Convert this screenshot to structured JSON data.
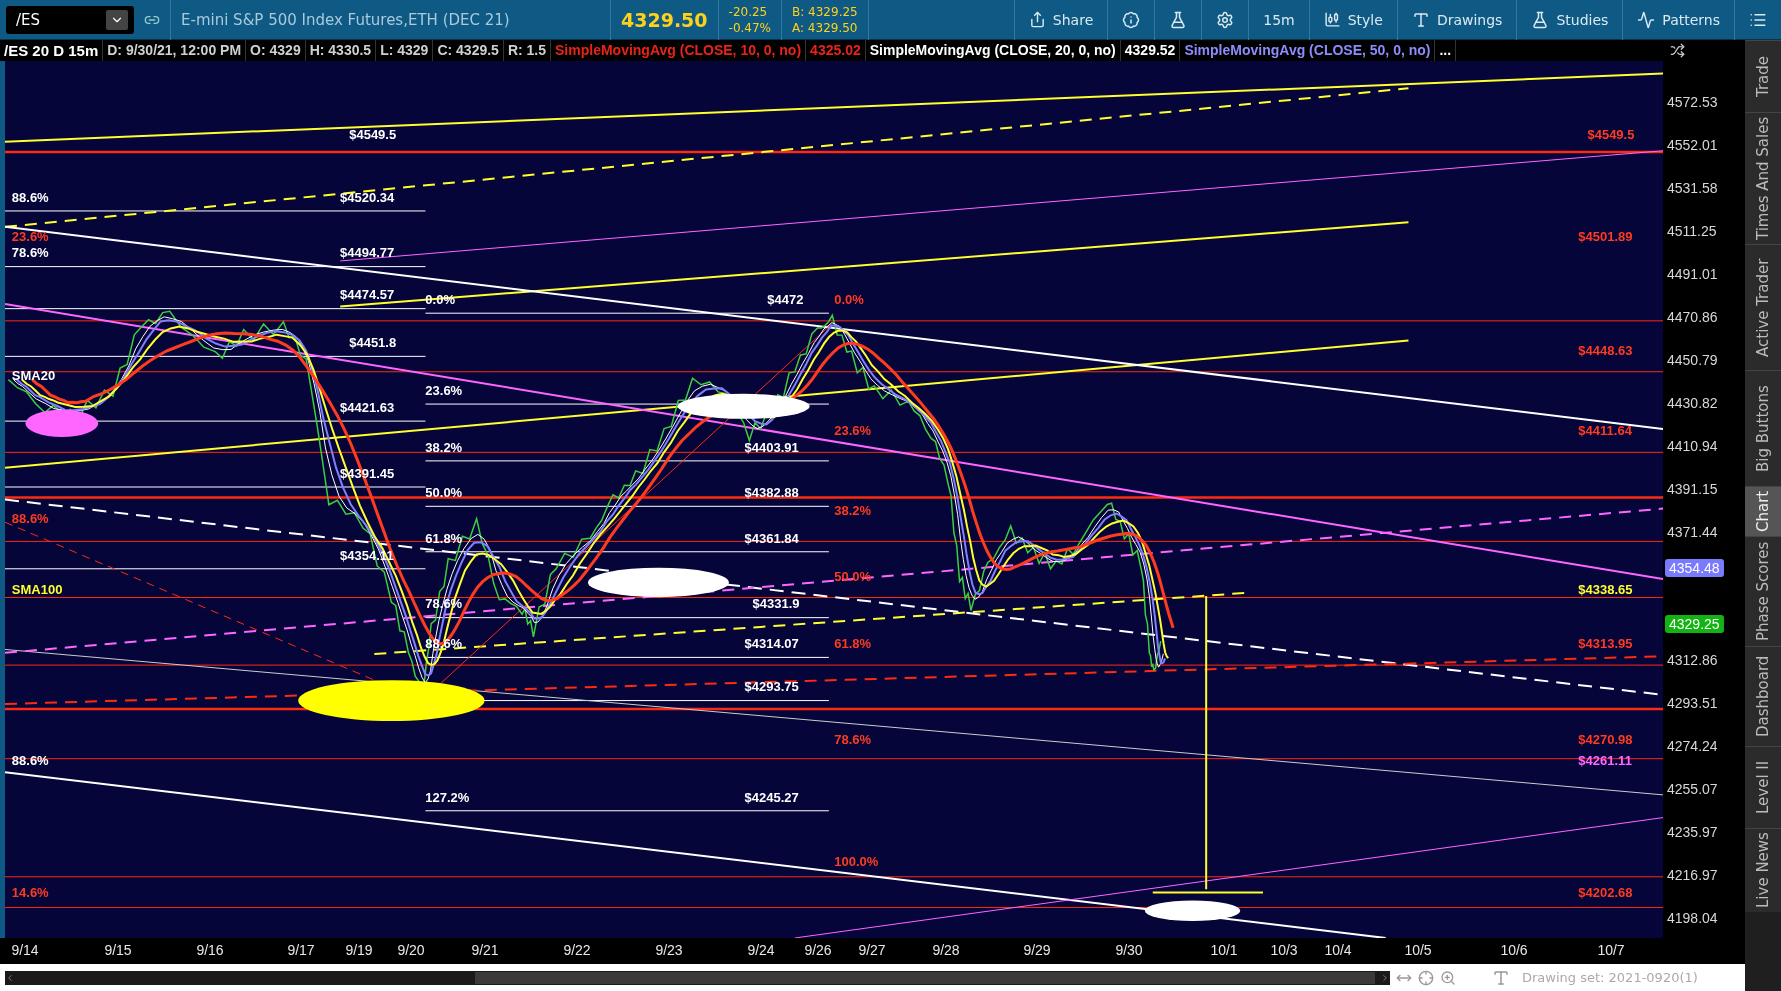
{
  "toolbar": {
    "symbol": "/ES",
    "description": "E-mini S&P 500 Index Futures,ETH (DEC 21)",
    "last_price": "4329.50",
    "change": "-20.25",
    "change_percent": "-0.47%",
    "bid": "B: 4329.25",
    "ask": "A: 4329.50",
    "buttons": [
      {
        "kind": "share",
        "label": "Share"
      },
      {
        "kind": "info"
      },
      {
        "kind": "flask"
      },
      {
        "kind": "gear"
      },
      {
        "kind": "plain",
        "label": "15m"
      },
      {
        "kind": "style",
        "label": "Style"
      },
      {
        "kind": "drawings",
        "label": "Drawings"
      },
      {
        "kind": "studies",
        "label": "Studies"
      },
      {
        "kind": "patterns",
        "label": "Patterns"
      },
      {
        "kind": "menu"
      }
    ]
  },
  "legend": [
    {
      "kind": "symbol",
      "text": "/ES 20 D 15m",
      "color": "#ffffff"
    },
    {
      "kind": "field",
      "text": "D: 9/30/21, 12:00 PM",
      "color": "#d0d0d0"
    },
    {
      "kind": "field",
      "text": "O: 4329",
      "color": "#d0d0d0"
    },
    {
      "kind": "field",
      "text": "H: 4330.5",
      "color": "#d0d0d0"
    },
    {
      "kind": "field",
      "text": "L: 4329",
      "color": "#d0d0d0"
    },
    {
      "kind": "field",
      "text": "C: 4329.5",
      "color": "#d0d0d0"
    },
    {
      "kind": "field",
      "text": "R: 1.5",
      "color": "#d0d0d0"
    },
    {
      "kind": "study",
      "text": "SimpleMovingAvg (CLOSE, 10, 0, no)",
      "color": "#e8241a"
    },
    {
      "kind": "study",
      "text": "4325.02",
      "color": "#e8241a"
    },
    {
      "kind": "study",
      "text": "SimpleMovingAvg (CLOSE, 20, 0, no)",
      "color": "#ffffff"
    },
    {
      "kind": "study",
      "text": "4329.52",
      "color": "#ffffff"
    },
    {
      "kind": "study",
      "text": "SimpleMovingAvg (CLOSE, 50, 0, no)",
      "color": "#8c8cff"
    },
    {
      "kind": "study",
      "text": "...",
      "color": "#ffffff"
    }
  ],
  "chart": {
    "annotations": [
      {
        "text": "88.6%",
        "color": "#ffffff"
      },
      {
        "text": "23.6%",
        "color": "#ff3b1f"
      },
      {
        "text": "78.6%",
        "color": "#ffffff"
      },
      {
        "text": "SMA20",
        "color": "#ffffff"
      },
      {
        "text": "88.6%",
        "color": "#ff3b1f"
      },
      {
        "text": "SMA100",
        "color": "#ffff2e"
      },
      {
        "text": "88.6%",
        "color": "#ffffff"
      },
      {
        "text": "14.6%",
        "color": "#ff3b1f"
      },
      {
        "text": "$4549.5",
        "color": "#ffffff"
      },
      {
        "text": "$4520.34",
        "color": "#ffffff"
      },
      {
        "text": "$4494.77",
        "color": "#ffffff"
      },
      {
        "text": "$4474.57",
        "color": "#ffffff"
      },
      {
        "text": "$4451.8",
        "color": "#ffffff"
      },
      {
        "text": "$4421.63",
        "color": "#ffffff"
      },
      {
        "text": "$4391.45",
        "color": "#ffffff"
      },
      {
        "text": "$4354.11",
        "color": "#ffffff"
      },
      {
        "text": "0.0%",
        "color": "#ffffff"
      },
      {
        "text": "23.6%",
        "color": "#ffffff"
      },
      {
        "text": "38.2%",
        "color": "#ffffff"
      },
      {
        "text": "50.0%",
        "color": "#ffffff"
      },
      {
        "text": "61.8%",
        "color": "#ffffff"
      },
      {
        "text": "78.6%",
        "color": "#ffffff"
      },
      {
        "text": "88.6%",
        "color": "#ffffff"
      },
      {
        "text": "127.2%",
        "color": "#ffffff"
      },
      {
        "text": "$4472",
        "color": "#ffffff"
      },
      {
        "text": "$4403.91",
        "color": "#ffffff"
      },
      {
        "text": "$4382.88",
        "color": "#ffffff"
      },
      {
        "text": "$4361.84",
        "color": "#ffffff"
      },
      {
        "text": "$4331.9",
        "color": "#ffffff"
      },
      {
        "text": "$4314.07",
        "color": "#ffffff"
      },
      {
        "text": "$4293.75",
        "color": "#ffffff"
      },
      {
        "text": "$4245.27",
        "color": "#ffffff"
      },
      {
        "text": "0.0%",
        "color": "#ff3b1f"
      },
      {
        "text": "23.6%",
        "color": "#ff3b1f"
      },
      {
        "text": "38.2%",
        "color": "#ff3b1f"
      },
      {
        "text": "50.0%",
        "color": "#ff3b1f"
      },
      {
        "text": "61.8%",
        "color": "#ff3b1f"
      },
      {
        "text": "78.6%",
        "color": "#ff3b1f"
      },
      {
        "text": "100.0%",
        "color": "#ff3b1f"
      },
      {
        "text": "$4549.5",
        "color": "#ff3b1f"
      },
      {
        "text": "$4501.89",
        "color": "#ff3b1f"
      },
      {
        "text": "$4448.63",
        "color": "#ff3b1f"
      },
      {
        "text": "$4411.64",
        "color": "#ff3b1f"
      },
      {
        "text": "$4338.65",
        "color": "#ffff2e"
      },
      {
        "text": "$4313.95",
        "color": "#ff3b1f"
      },
      {
        "text": "$4270.98",
        "color": "#ff3b1f"
      },
      {
        "text": "$4261.11",
        "color": "#ff66ff"
      },
      {
        "text": "$4202.68",
        "color": "#ff3b1f"
      }
    ],
    "y_axis": [
      "4572.53",
      "4552.01",
      "4531.58",
      "4511.25",
      "4491.01",
      "4470.86",
      "4450.79",
      "4430.82",
      "4410.94",
      "4391.15",
      "4371.44",
      "4312.86",
      "4293.51",
      "4274.24",
      "4255.07",
      "4235.97",
      "4216.97",
      "4198.04"
    ],
    "price_badges": [
      {
        "text": "4354.48",
        "color": "#7a7aff"
      },
      {
        "text": "4329.25",
        "color": "#13b313"
      }
    ],
    "x_axis": [
      "9/14",
      "9/15",
      "9/16",
      "9/17",
      "9/19",
      "9/20",
      "9/21",
      "9/22",
      "9/23",
      "9/24",
      "9/26",
      "9/27",
      "9/28",
      "9/29",
      "9/30",
      "10/1",
      "10/3",
      "10/4",
      "10/5",
      "10/6",
      "10/7"
    ]
  },
  "side_tabs": [
    {
      "label": "Trade",
      "selected": false
    },
    {
      "label": "Times And Sales",
      "selected": false
    },
    {
      "label": "Active Trader",
      "selected": false
    },
    {
      "label": "Big Buttons",
      "selected": false
    },
    {
      "label": "Chart",
      "selected": true
    },
    {
      "label": "Phase Scores",
      "selected": false
    },
    {
      "label": "Dashboard",
      "selected": false
    },
    {
      "label": "Level II",
      "selected": false
    },
    {
      "label": "Live News",
      "selected": false
    }
  ],
  "bottom_bar": {
    "drawing_set": "Drawing set: 2021-0920(1)"
  }
}
